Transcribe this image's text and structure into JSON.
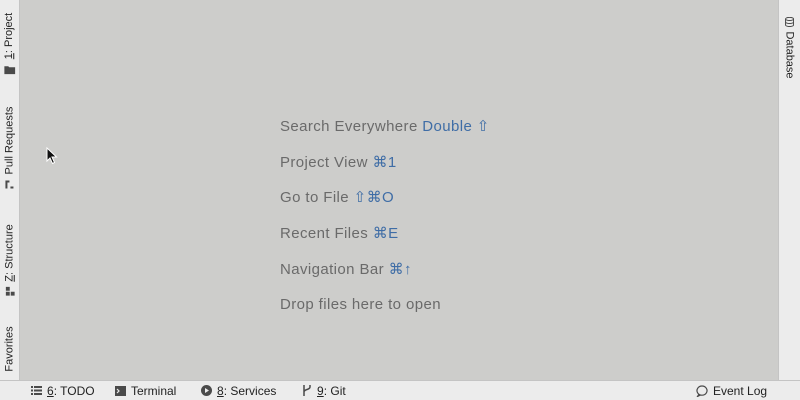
{
  "left_tabs": {
    "project": {
      "mnemonic": "1",
      "label": ": Project"
    },
    "pull_requests": {
      "label": "Pull Requests"
    },
    "structure": {
      "mnemonic": "Z",
      "label": ": Structure"
    },
    "favorites": {
      "label": "Favorites"
    }
  },
  "right_tabs": {
    "database": {
      "label": "Database"
    }
  },
  "editor_hints": {
    "search_everywhere": {
      "label": "Search Everywhere",
      "shortcut": "Double ⇧"
    },
    "project_view": {
      "label": "Project View",
      "shortcut": "⌘1"
    },
    "go_to_file": {
      "label": "Go to File",
      "shortcut": "⇧⌘O"
    },
    "recent_files": {
      "label": "Recent Files",
      "shortcut": "⌘E"
    },
    "navigation_bar": {
      "label": "Navigation Bar",
      "shortcut": "⌘↑"
    },
    "drop_files": {
      "label": "Drop files here to open"
    }
  },
  "bottom_tabs": {
    "todo": {
      "mnemonic": "6",
      "label": ": TODO",
      "icon": "list-icon"
    },
    "terminal": {
      "label": "Terminal",
      "icon": "terminal-icon"
    },
    "services": {
      "mnemonic": "8",
      "label": ": Services",
      "icon": "play-icon"
    },
    "git": {
      "mnemonic": "9",
      "label": ": Git",
      "icon": "git-branch-icon"
    },
    "event_log": {
      "label": "Event Log",
      "icon": "speech-bubble-icon"
    }
  },
  "colors": {
    "editor_bg": "#cdcdcb",
    "stripe_bg": "#ececec",
    "hint_text": "#6a6a6a",
    "shortcut_text": "#3f6da6"
  }
}
